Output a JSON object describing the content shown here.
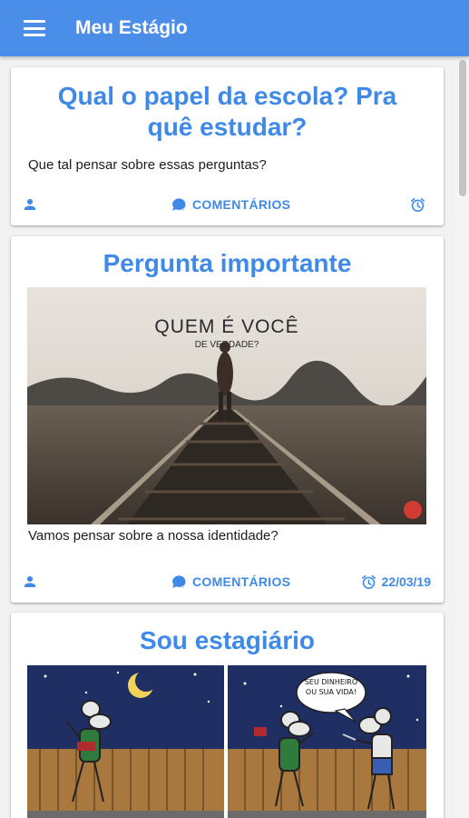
{
  "appbar": {
    "title": "Meu Estágio",
    "menu_icon": "hamburger-menu-icon"
  },
  "colors": {
    "primary": "#4a8eea",
    "title": "#3f8ae8"
  },
  "cards": [
    {
      "title": "Qual o papel da escola? Pra quê estudar?",
      "text": "Que tal pensar sobre essas perguntas?",
      "actions": {
        "user_icon": "person-icon",
        "comments_label": "COMENTÁRIOS",
        "comments_icon": "chat-bubbles-icon",
        "date_icon": "alarm-clock-icon",
        "date": ""
      }
    },
    {
      "title": "Pergunta importante",
      "image": {
        "headline": "QUEM É VOCÊ",
        "subline": "DE VERDADE?"
      },
      "text": "Vamos pensar sobre a nossa identidade?",
      "actions": {
        "user_icon": "person-icon",
        "comments_label": "COMENTÁRIOS",
        "comments_icon": "chat-bubbles-icon",
        "date_icon": "alarm-clock-icon",
        "date": "22/03/19"
      }
    },
    {
      "title": "Sou estagiário",
      "image": {
        "speech": "SEU DINHEIRO OU SUA VIDA!"
      }
    }
  ]
}
